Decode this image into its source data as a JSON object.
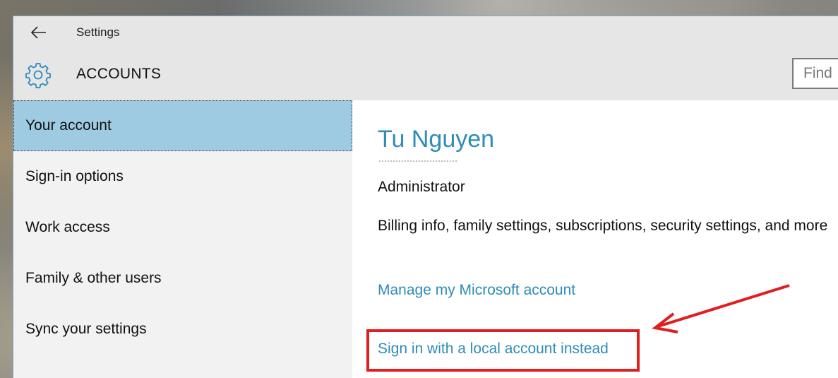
{
  "window": {
    "title": "Settings"
  },
  "header": {
    "section_title": "ACCOUNTS",
    "search_placeholder": "Find"
  },
  "sidebar": {
    "items": [
      {
        "label": "Your account",
        "selected": true
      },
      {
        "label": "Sign-in options",
        "selected": false
      },
      {
        "label": "Work access",
        "selected": false
      },
      {
        "label": "Family & other users",
        "selected": false
      },
      {
        "label": "Sync your settings",
        "selected": false
      }
    ]
  },
  "account": {
    "name": "Tu Nguyen",
    "role": "Administrator",
    "billing_text": "Billing info, family settings, subscriptions, security settings, and more",
    "manage_link": "Manage my Microsoft account",
    "local_link": "Sign in with a local account instead"
  },
  "icons": {
    "back": "back-arrow-icon",
    "section": "gear-icon"
  },
  "colors": {
    "accent": "#2e8cb8",
    "selected_bg": "#9fcbe2",
    "annotation": "#e01e1e"
  }
}
